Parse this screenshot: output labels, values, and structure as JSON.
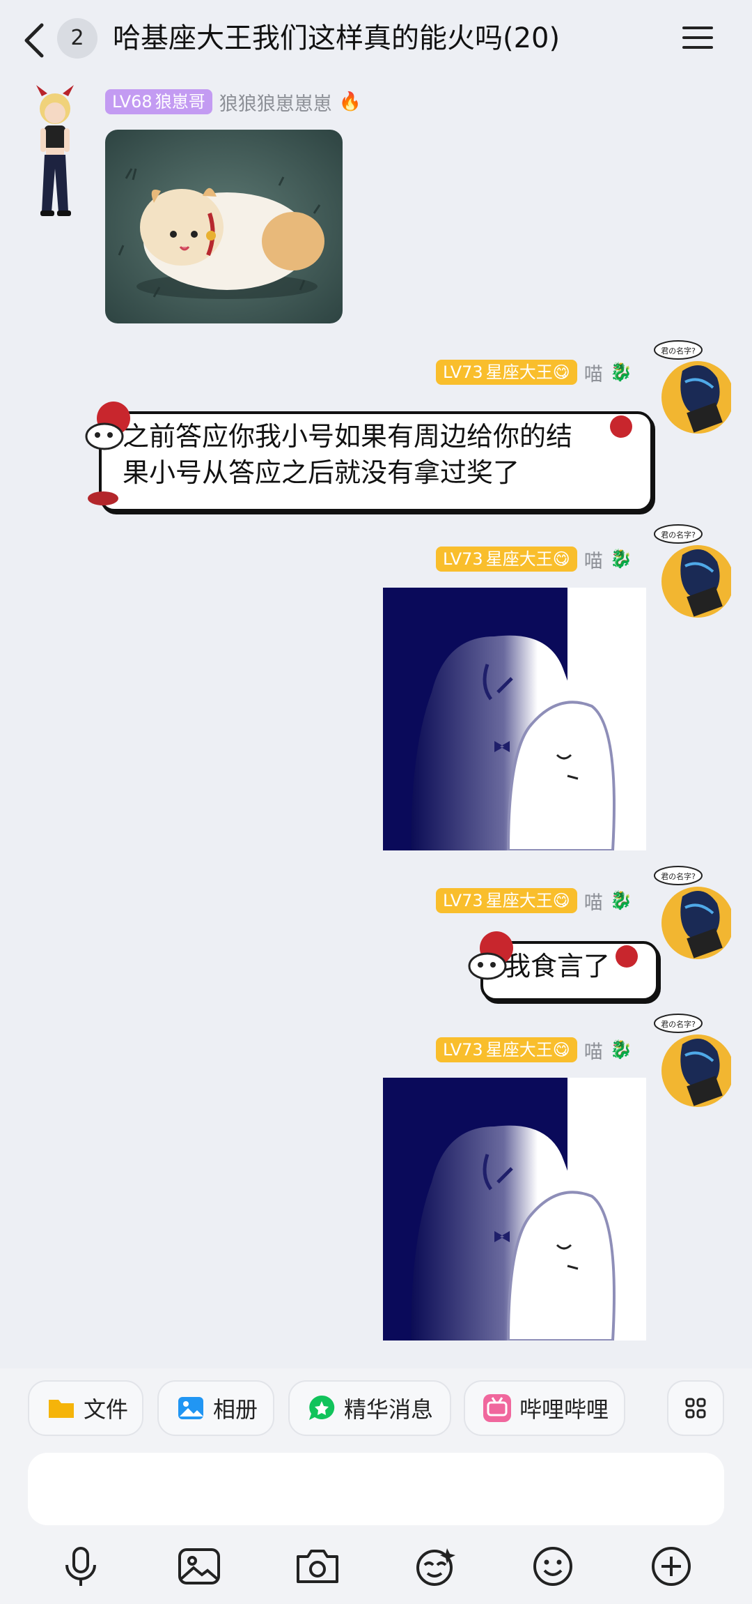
{
  "header": {
    "unread_count": "2",
    "title": "哈基座大王我们这样真的能火吗(20)"
  },
  "messages": [
    {
      "type": "image",
      "side": "left",
      "level": "LV68",
      "title_tag": "狼崽哥",
      "nickname": "狼狼狼崽崽崽",
      "badge_emoji": "🔥"
    },
    {
      "type": "text",
      "side": "right",
      "level": "LV73",
      "title_tag": "星座大王😋",
      "nickname": "喵",
      "line1": "之前答应你我小号如果有周边给你的结",
      "line2": "果小号从答应之后就没有拿过奖了"
    },
    {
      "type": "image",
      "side": "right",
      "level": "LV73",
      "title_tag": "星座大王😋",
      "nickname": "喵"
    },
    {
      "type": "text",
      "side": "right",
      "level": "LV73",
      "title_tag": "星座大王😋",
      "nickname": "喵",
      "line1": "我食言了"
    },
    {
      "type": "image",
      "side": "right",
      "level": "LV73",
      "title_tag": "星座大王😋",
      "nickname": "喵"
    }
  ],
  "avatar_speech_text": "君の名字?",
  "quick_actions": [
    {
      "label": "文件",
      "icon": "folder-icon",
      "color": "#F5B40A"
    },
    {
      "label": "相册",
      "icon": "album-icon",
      "color": "#2196F3"
    },
    {
      "label": "精华消息",
      "icon": "star-chat-icon",
      "color": "#11C35B"
    },
    {
      "label": "哔哩哔哩",
      "icon": "bilibili-icon",
      "color": "#F0679D"
    }
  ],
  "input": {
    "value": "",
    "placeholder": ""
  },
  "bottom_icons": [
    "microphone-icon",
    "image-icon",
    "camera-icon",
    "sticker-icon",
    "emoji-icon",
    "plus-icon"
  ]
}
